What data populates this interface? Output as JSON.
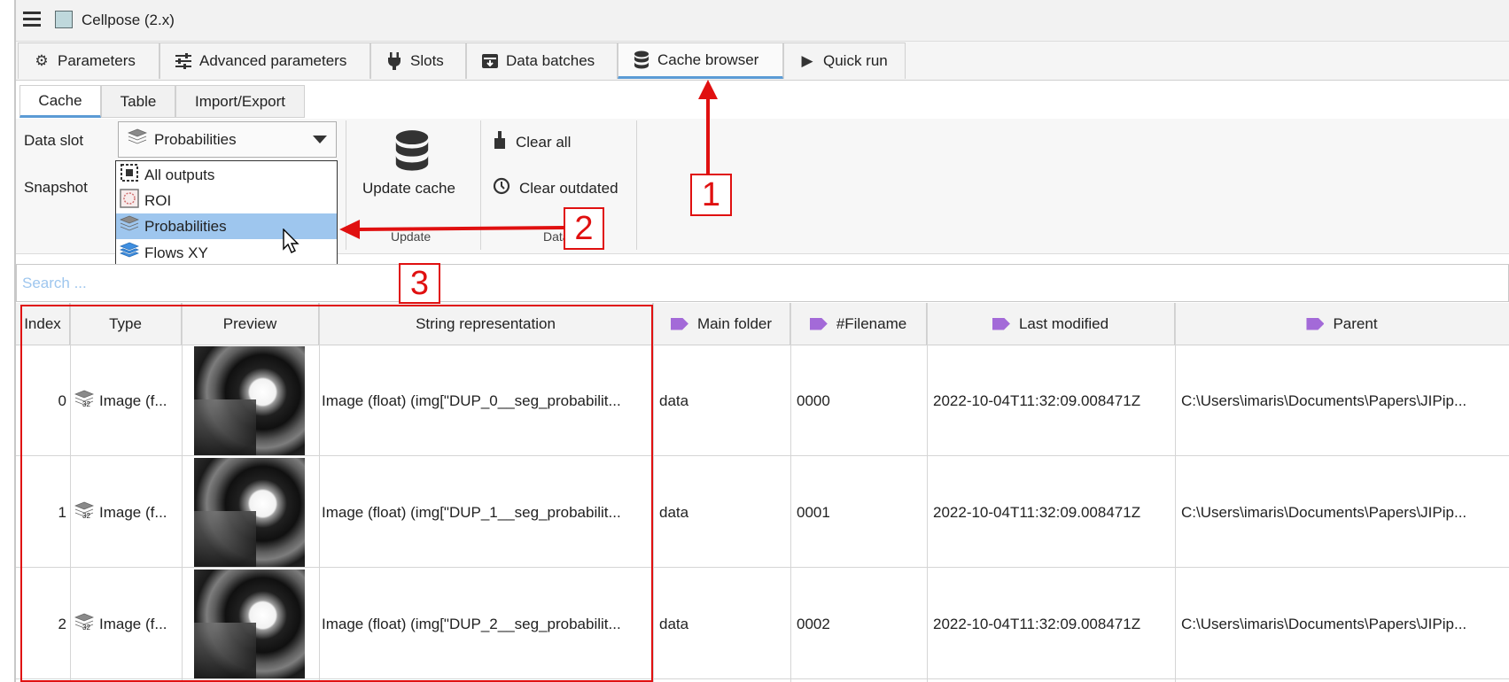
{
  "window": {
    "title": "Cellpose (2.x)"
  },
  "main_tabs": [
    {
      "label": "Parameters",
      "icon": "gear-icon"
    },
    {
      "label": "Advanced parameters",
      "icon": "sliders-icon"
    },
    {
      "label": "Slots",
      "icon": "plug-icon"
    },
    {
      "label": "Data batches",
      "icon": "archive-icon"
    },
    {
      "label": "Cache browser",
      "icon": "database-icon",
      "active": true
    },
    {
      "label": "Quick run",
      "icon": "play-icon"
    }
  ],
  "sub_tabs": [
    {
      "label": "Cache",
      "active": true
    },
    {
      "label": "Table"
    },
    {
      "label": "Import/Export"
    }
  ],
  "ribbon": {
    "data_slot_label": "Data slot",
    "data_slot_value": "Probabilities",
    "snapshot_label": "Snapshot",
    "update_cache_label": "Update cache",
    "clear_all_label": "Clear all",
    "clear_outdated_label": "Clear outdated",
    "group_update": "Update",
    "group_data": "Data"
  },
  "dropdown": {
    "options": [
      {
        "label": "All outputs",
        "icon": "all-outputs-icon"
      },
      {
        "label": "ROI",
        "icon": "roi-icon"
      },
      {
        "label": "Probabilities",
        "icon": "image-stack-icon",
        "selected": true
      },
      {
        "label": "Flows XY",
        "icon": "flows-stack-icon"
      }
    ]
  },
  "search": {
    "placeholder": "Search ..."
  },
  "table": {
    "columns": [
      "Index",
      "Type",
      "Preview",
      "String representation",
      "Main folder",
      "#Filename",
      "Last modified",
      "Parent"
    ],
    "rows": [
      {
        "index": "0",
        "type": "Image (f...",
        "string": "Image (float) (img[\"DUP_0__seg_probabilit...",
        "main_folder": "data",
        "filename": "0000",
        "modified": "2022-10-04T11:32:09.008471Z",
        "parent": "C:\\Users\\imaris\\Documents\\Papers\\JIPip..."
      },
      {
        "index": "1",
        "type": "Image (f...",
        "string": "Image (float) (img[\"DUP_1__seg_probabilit...",
        "main_folder": "data",
        "filename": "0001",
        "modified": "2022-10-04T11:32:09.008471Z",
        "parent": "C:\\Users\\imaris\\Documents\\Papers\\JIPip..."
      },
      {
        "index": "2",
        "type": "Image (f...",
        "string": "Image (float) (img[\"DUP_2__seg_probabilit...",
        "main_folder": "data",
        "filename": "0002",
        "modified": "2022-10-04T11:32:09.008471Z",
        "parent": "C:\\Users\\imaris\\Documents\\Papers\\JIPip..."
      }
    ]
  },
  "annotations": {
    "n1": "1",
    "n2": "2",
    "n3": "3"
  },
  "colors": {
    "accent": "#5b9bd5",
    "selection": "#9ec6ee",
    "annotation": "#e01010",
    "tag": "#a36ad8"
  }
}
